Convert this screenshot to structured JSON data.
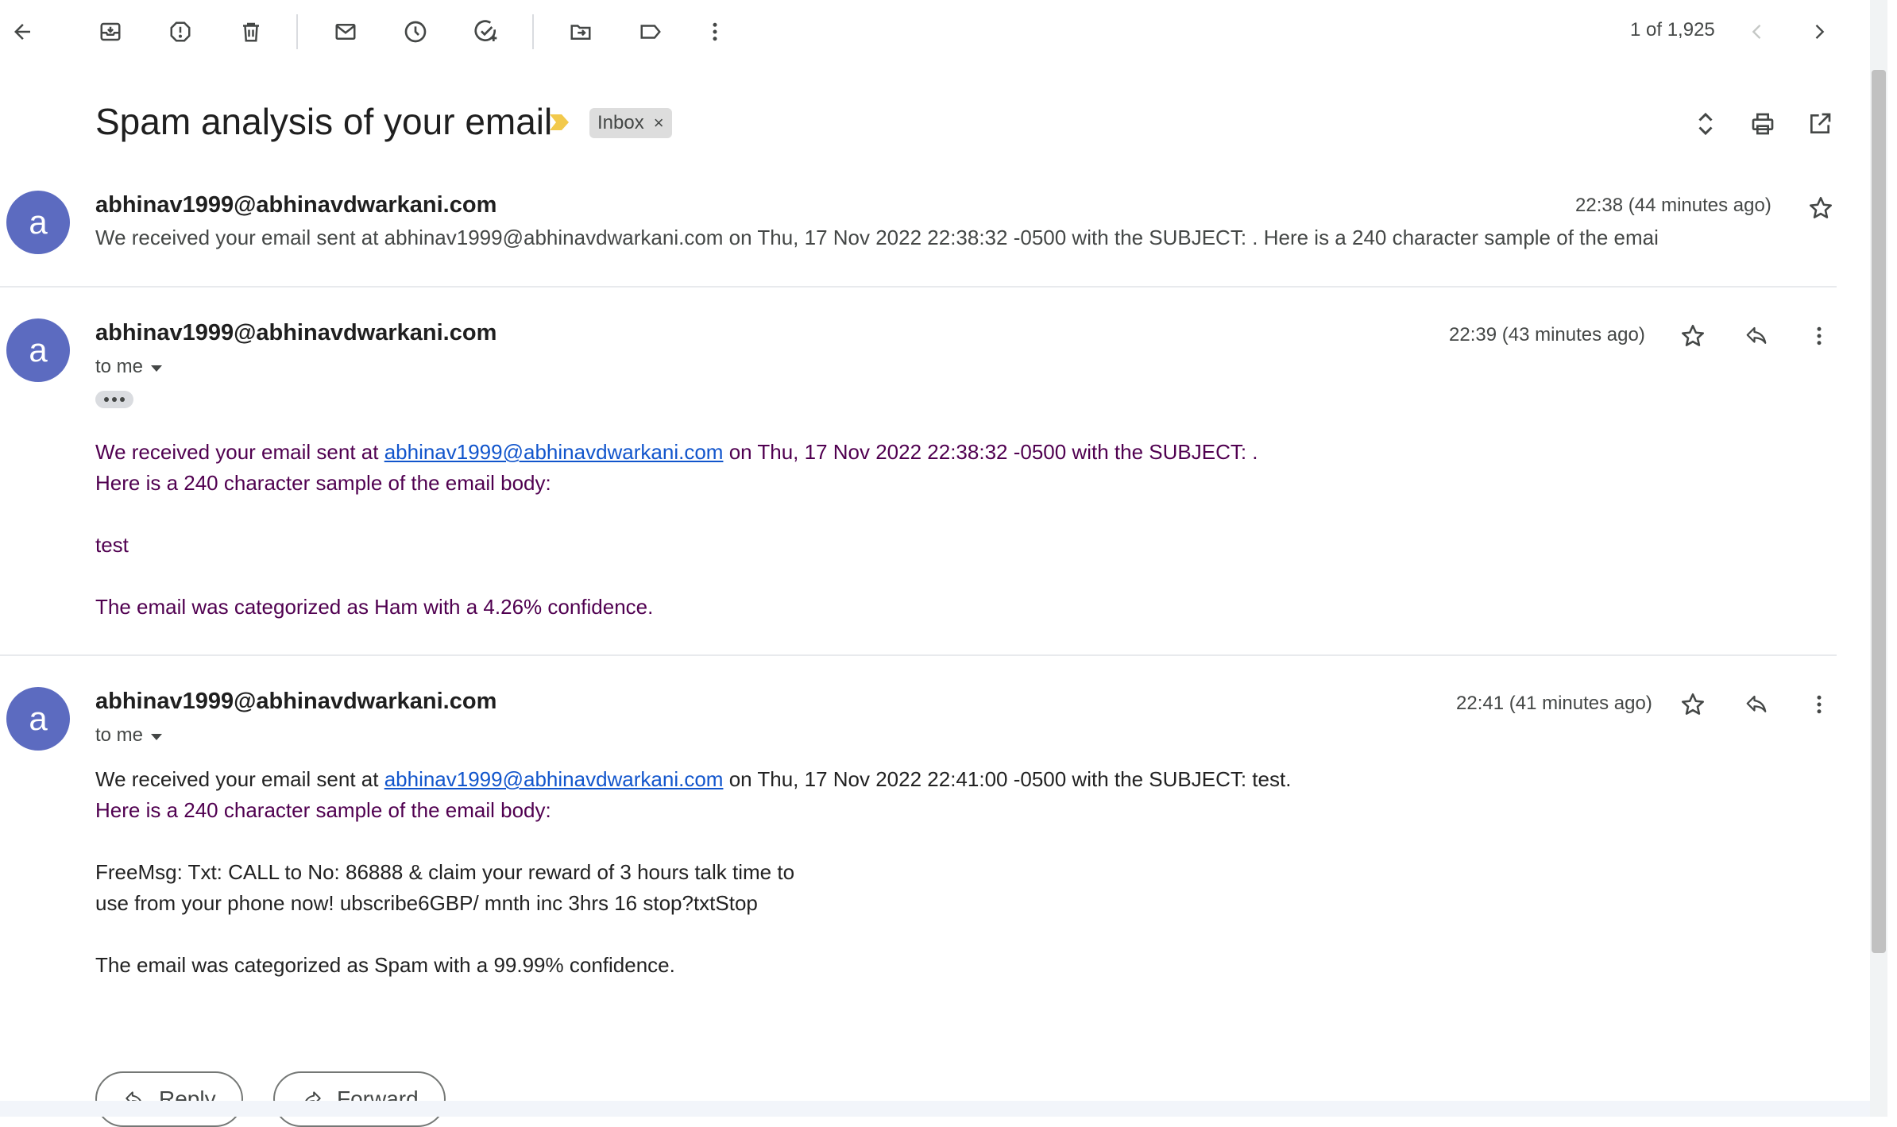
{
  "toolbar": {
    "pager_text": "1 of 1,925"
  },
  "thread": {
    "subject": "Spam analysis of your email",
    "label": "Inbox",
    "label_remove": "×"
  },
  "messages": [
    {
      "avatar_letter": "a",
      "sender": "abhinav1999@abhinavdwarkani.com",
      "time": "22:38 (44 minutes ago)",
      "snippet": "We received your email sent at abhinav1999@abhinavdwarkani.com on Thu, 17 Nov 2022 22:38:32 -0500 with the SUBJECT: . Here is a 240 character sample of the emai"
    },
    {
      "avatar_letter": "a",
      "sender": "abhinav1999@abhinavdwarkani.com",
      "time": "22:39 (43 minutes ago)",
      "to_me": "to me",
      "line1_pre": "We received your email sent at ",
      "line1_link": "abhinav1999@abhinavdwarkani.com",
      "line1_post": " on Thu, 17 Nov 2022 22:38:32 -0500 with the SUBJECT: .",
      "line2": "Here is a 240 character sample of the email body:",
      "body_sample": "test",
      "result": "The email was categorized as Ham with a 4.26% confidence."
    },
    {
      "avatar_letter": "a",
      "sender": "abhinav1999@abhinavdwarkani.com",
      "time": "22:41 (41 minutes ago)",
      "to_me": "to me",
      "line1_pre": "We received your email sent at ",
      "line1_link": "abhinav1999@abhinavdwarkani.com",
      "line1_post": " on Thu, 17 Nov 2022 22:41:00 -0500 with the SUBJECT: test.",
      "line2": "Here is a 240 character sample of the email body:",
      "body_line_a": "FreeMsg: Txt: CALL to No: 86888 & claim your reward of 3 hours talk time to",
      "body_line_b": "use from your phone now! ubscribe6GBP/ mnth inc 3hrs 16 stop?txtStop",
      "result": "The email was categorized as Spam with a 99.99% confidence."
    }
  ],
  "actions": {
    "reply": "Reply",
    "forward": "Forward"
  },
  "colors": {
    "avatar": "#5c6bc0",
    "link": "#1155cc",
    "quoted_text": "#500050",
    "importance_marker": "#f2c94c"
  },
  "icons": [
    "back-arrow-icon",
    "archive-icon",
    "report-spam-icon",
    "delete-icon",
    "mark-unread-icon",
    "snooze-icon",
    "add-task-icon",
    "move-to-icon",
    "label-icon",
    "more-vert-icon",
    "chevron-left-icon",
    "chevron-right-icon",
    "importance-marker-icon",
    "expand-all-icon",
    "print-icon",
    "open-new-window-icon",
    "star-icon",
    "reply-icon",
    "forward-icon"
  ]
}
